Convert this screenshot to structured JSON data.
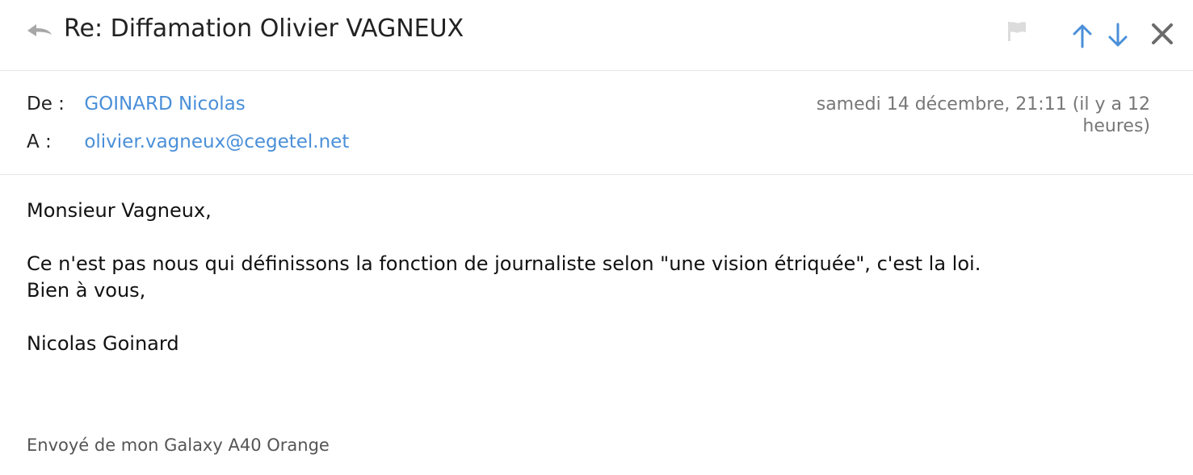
{
  "header": {
    "subject": "Re: Diffamation Olivier VAGNEUX",
    "icons": [
      "reply-icon",
      "flag-icon",
      "arrow-up-icon",
      "arrow-down-icon",
      "close-icon"
    ]
  },
  "meta": {
    "from_label": "De :",
    "from_value": "GOINARD Nicolas",
    "to_label": "A :",
    "to_value": "olivier.vagneux@cegetel.net",
    "date": "samedi 14 décembre, 21:11 (il y a 12 heures)"
  },
  "body": {
    "greeting": "Monsieur Vagneux,",
    "line1": "Ce n'est pas nous qui définissons la fonction de journaliste selon \"une vision étriquée\", c'est la loi.",
    "line2": "Bien à vous,",
    "signature": "Nicolas Goinard",
    "sent_from": "Envoyé de mon Galaxy A40 Orange"
  },
  "colors": {
    "link": "#4a8fd8",
    "icon_grey": "#9e9e9e",
    "flag_grey": "#dcdcdc",
    "arrow_blue": "#4a8fd8",
    "close_grey": "#6b6b6b"
  }
}
